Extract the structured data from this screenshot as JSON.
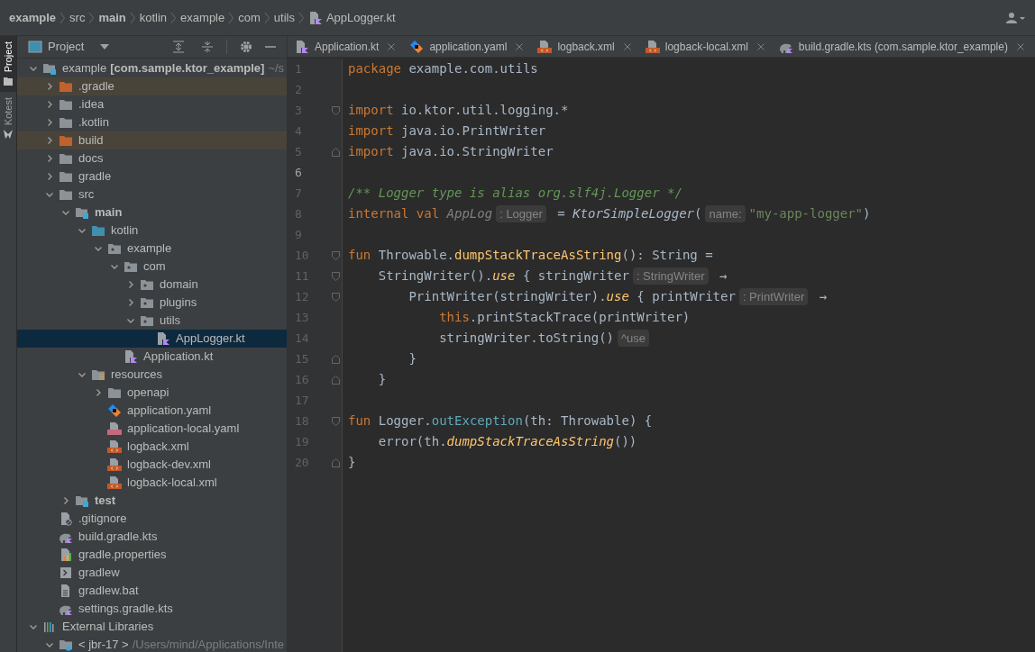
{
  "breadcrumbs": [
    {
      "label": "example",
      "bold": true
    },
    {
      "label": "src",
      "bold": false
    },
    {
      "label": "main",
      "bold": true
    },
    {
      "label": "kotlin",
      "bold": false
    },
    {
      "label": "example",
      "bold": false
    },
    {
      "label": "com",
      "bold": false
    },
    {
      "label": "utils",
      "bold": false
    },
    {
      "label": "AppLogger.kt",
      "bold": false,
      "kind": "kotlin"
    }
  ],
  "tool_strip": [
    {
      "label": "Project",
      "selected": true
    },
    {
      "label": "Kotest",
      "selected": false
    }
  ],
  "project_panel": {
    "title": "Project"
  },
  "tree": [
    {
      "label": "example",
      "module": "[com.sample.ktor_example]",
      "path": "~/s",
      "kind": "module",
      "expanded": true,
      "selected": false,
      "excluded": false,
      "bold": false,
      "children": [
        {
          "label": ".gradle",
          "kind": "folder",
          "expanded": false,
          "selected": false,
          "excluded": true,
          "bold": false
        },
        {
          "label": ".idea",
          "kind": "folder",
          "expanded": false,
          "selected": false,
          "excluded": false,
          "bold": false
        },
        {
          "label": ".kotlin",
          "kind": "folder",
          "expanded": false,
          "selected": false,
          "excluded": false,
          "bold": false
        },
        {
          "label": "build",
          "kind": "folder",
          "expanded": false,
          "selected": false,
          "excluded": true,
          "bold": false
        },
        {
          "label": "docs",
          "kind": "folder",
          "expanded": false,
          "selected": false,
          "excluded": false,
          "bold": false
        },
        {
          "label": "gradle",
          "kind": "folder",
          "expanded": false,
          "selected": false,
          "excluded": false,
          "bold": false
        },
        {
          "label": "src",
          "kind": "folder",
          "expanded": true,
          "selected": false,
          "excluded": false,
          "bold": false,
          "children": [
            {
              "label": "main",
              "kind": "module",
              "expanded": true,
              "selected": false,
              "excluded": false,
              "bold": true,
              "children": [
                {
                  "label": "kotlin",
                  "kind": "source",
                  "expanded": true,
                  "selected": false,
                  "excluded": false,
                  "bold": false,
                  "children": [
                    {
                      "label": "example",
                      "kind": "package",
                      "expanded": true,
                      "selected": false,
                      "excluded": false,
                      "bold": false,
                      "children": [
                        {
                          "label": "com",
                          "kind": "package",
                          "expanded": true,
                          "selected": false,
                          "excluded": false,
                          "bold": false,
                          "children": [
                            {
                              "label": "domain",
                              "kind": "package",
                              "expanded": false,
                              "selected": false,
                              "excluded": false,
                              "bold": false
                            },
                            {
                              "label": "plugins",
                              "kind": "package",
                              "expanded": false,
                              "selected": false,
                              "excluded": false,
                              "bold": false
                            },
                            {
                              "label": "utils",
                              "kind": "package",
                              "expanded": true,
                              "selected": false,
                              "excluded": false,
                              "bold": false,
                              "children": [
                                {
                                  "label": "AppLogger.kt",
                                  "kind": "kotlin",
                                  "selected": true,
                                  "bold": false
                                }
                              ]
                            }
                          ]
                        },
                        {
                          "label": "Application.kt",
                          "kind": "kotlin",
                          "selected": false,
                          "bold": false
                        }
                      ]
                    }
                  ]
                },
                {
                  "label": "resources",
                  "kind": "resources",
                  "expanded": true,
                  "selected": false,
                  "excluded": false,
                  "bold": false,
                  "children": [
                    {
                      "label": "openapi",
                      "kind": "folder",
                      "expanded": false,
                      "selected": false,
                      "excluded": false,
                      "bold": false
                    },
                    {
                      "label": "application.yaml",
                      "kind": "ktor",
                      "selected": false,
                      "bold": false
                    },
                    {
                      "label": "application-local.yaml",
                      "kind": "yaml",
                      "selected": false,
                      "bold": false
                    },
                    {
                      "label": "logback.xml",
                      "kind": "xml",
                      "selected": false,
                      "bold": false
                    },
                    {
                      "label": "logback-dev.xml",
                      "kind": "xml",
                      "selected": false,
                      "bold": false
                    },
                    {
                      "label": "logback-local.xml",
                      "kind": "xml",
                      "selected": false,
                      "bold": false
                    }
                  ]
                }
              ]
            },
            {
              "label": "test",
              "kind": "module",
              "expanded": false,
              "selected": false,
              "excluded": false,
              "bold": true
            }
          ]
        },
        {
          "label": ".gitignore",
          "kind": "ignore",
          "selected": false,
          "bold": false
        },
        {
          "label": "build.gradle.kts",
          "kind": "gradle",
          "selected": false,
          "bold": false
        },
        {
          "label": "gradle.properties",
          "kind": "properties",
          "selected": false,
          "bold": false
        },
        {
          "label": "gradlew",
          "kind": "script",
          "selected": false,
          "bold": false
        },
        {
          "label": "gradlew.bat",
          "kind": "text",
          "selected": false,
          "bold": false
        },
        {
          "label": "settings.gradle.kts",
          "kind": "gradle",
          "selected": false,
          "bold": false
        }
      ]
    },
    {
      "label": "External Libraries",
      "kind": "libraries",
      "expanded": true,
      "selected": false,
      "excluded": false,
      "bold": false,
      "children": [
        {
          "label": "< jbr-17 >",
          "path": "/Users/mind/Applications/Inte",
          "kind": "jdk",
          "expanded": true,
          "selected": false,
          "excluded": false,
          "bold": false
        }
      ]
    }
  ],
  "tabs": [
    {
      "label": "Application.kt",
      "kind": "kotlin",
      "selected": false
    },
    {
      "label": "application.yaml",
      "kind": "ktor",
      "selected": false
    },
    {
      "label": "logback.xml",
      "kind": "xml",
      "selected": false
    },
    {
      "label": "logback-local.xml",
      "kind": "xml",
      "selected": false
    },
    {
      "label": "build.gradle.kts (com.sample.ktor_example)",
      "kind": "gradle",
      "selected": false
    }
  ],
  "code": [
    {
      "number": "1",
      "current": false,
      "kind": "plain",
      "tokens": [
        {
          "kind": "kw",
          "text": "package"
        },
        {
          "kind": "plain",
          "text": " example.com.utils"
        }
      ]
    },
    {
      "number": "2",
      "current": false,
      "kind": "plain"
    },
    {
      "number": "3",
      "current": false,
      "kind": "fold-start",
      "tokens": [
        {
          "kind": "kw",
          "text": "import"
        },
        {
          "kind": "plain",
          "text": " io.ktor.util.logging.*"
        }
      ]
    },
    {
      "number": "4",
      "current": false,
      "kind": "plain",
      "tokens": [
        {
          "kind": "kw",
          "text": "import"
        },
        {
          "kind": "plain",
          "text": " java.io.PrintWriter"
        }
      ]
    },
    {
      "number": "5",
      "current": false,
      "kind": "fold-end",
      "tokens": [
        {
          "kind": "kw",
          "text": "import"
        },
        {
          "kind": "plain",
          "text": " java.io.StringWriter"
        }
      ]
    },
    {
      "number": "6",
      "current": true,
      "kind": "plain"
    },
    {
      "number": "7",
      "current": false,
      "kind": "plain",
      "tokens": [
        {
          "kind": "comment",
          "text": "/** Logger type is alias org.slf4j.Logger */"
        }
      ]
    },
    {
      "number": "8",
      "current": false,
      "kind": "plain",
      "tokens": [
        {
          "kind": "kw",
          "text": "internal val "
        },
        {
          "kind": "unused",
          "text": "AppLog"
        },
        {
          "kind": "hint",
          "text": ": Logger"
        },
        {
          "kind": "plain",
          "text": " = "
        },
        {
          "kind": "call",
          "text": "KtorSimpleLogger"
        },
        {
          "kind": "plain",
          "text": "("
        },
        {
          "kind": "hint",
          "text": "name:"
        },
        {
          "kind": "string",
          "text": "\"my-app-logger\""
        },
        {
          "kind": "plain",
          "text": ")"
        }
      ]
    },
    {
      "number": "9",
      "current": false,
      "kind": "plain"
    },
    {
      "number": "10",
      "current": false,
      "kind": "fold-start",
      "tokens": [
        {
          "kind": "kw",
          "text": "fun "
        },
        {
          "kind": "plain",
          "text": "Throwable."
        },
        {
          "kind": "fn",
          "text": "dumpStackTraceAsString"
        },
        {
          "kind": "plain",
          "text": "(): String ="
        }
      ]
    },
    {
      "number": "11",
      "current": false,
      "kind": "fold-start",
      "tokens": [
        {
          "kind": "plain",
          "text": "    StringWriter()."
        },
        {
          "kind": "ext",
          "text": "use"
        },
        {
          "kind": "plain",
          "text": " { stringWriter"
        },
        {
          "kind": "hint",
          "text": ": StringWriter"
        },
        {
          "kind": "plain",
          "text": " →"
        }
      ]
    },
    {
      "number": "12",
      "current": false,
      "kind": "fold-start",
      "tokens": [
        {
          "kind": "plain",
          "text": "        PrintWriter(stringWriter)."
        },
        {
          "kind": "ext",
          "text": "use"
        },
        {
          "kind": "plain",
          "text": " { printWriter"
        },
        {
          "kind": "hint",
          "text": ": PrintWriter"
        },
        {
          "kind": "plain",
          "text": " →"
        }
      ]
    },
    {
      "number": "13",
      "current": false,
      "kind": "plain",
      "tokens": [
        {
          "kind": "kw",
          "text": "            this"
        },
        {
          "kind": "plain",
          "text": ".printStackTrace(printWriter)"
        }
      ]
    },
    {
      "number": "14",
      "current": false,
      "kind": "plain",
      "tokens": [
        {
          "kind": "plain",
          "text": "            stringWriter.toString()"
        },
        {
          "kind": "hint",
          "text": "^use"
        }
      ]
    },
    {
      "number": "15",
      "current": false,
      "kind": "fold-end",
      "tokens": [
        {
          "kind": "plain",
          "text": "        }"
        }
      ]
    },
    {
      "number": "16",
      "current": false,
      "kind": "fold-end",
      "tokens": [
        {
          "kind": "plain",
          "text": "    }"
        }
      ]
    },
    {
      "number": "17",
      "current": false,
      "kind": "plain"
    },
    {
      "number": "18",
      "current": false,
      "kind": "fold-start",
      "tokens": [
        {
          "kind": "kw",
          "text": "fun "
        },
        {
          "kind": "plain",
          "text": "Logger."
        },
        {
          "kind": "member",
          "text": "outException"
        },
        {
          "kind": "plain",
          "text": "(th: Throwable) {"
        }
      ]
    },
    {
      "number": "19",
      "current": false,
      "kind": "plain",
      "tokens": [
        {
          "kind": "plain",
          "text": "    error(th."
        },
        {
          "kind": "ext",
          "text": "dumpStackTraceAsString"
        },
        {
          "kind": "plain",
          "text": "())"
        }
      ]
    },
    {
      "number": "20",
      "current": false,
      "kind": "fold-end",
      "tokens": [
        {
          "kind": "plain",
          "text": "}"
        }
      ]
    }
  ]
}
